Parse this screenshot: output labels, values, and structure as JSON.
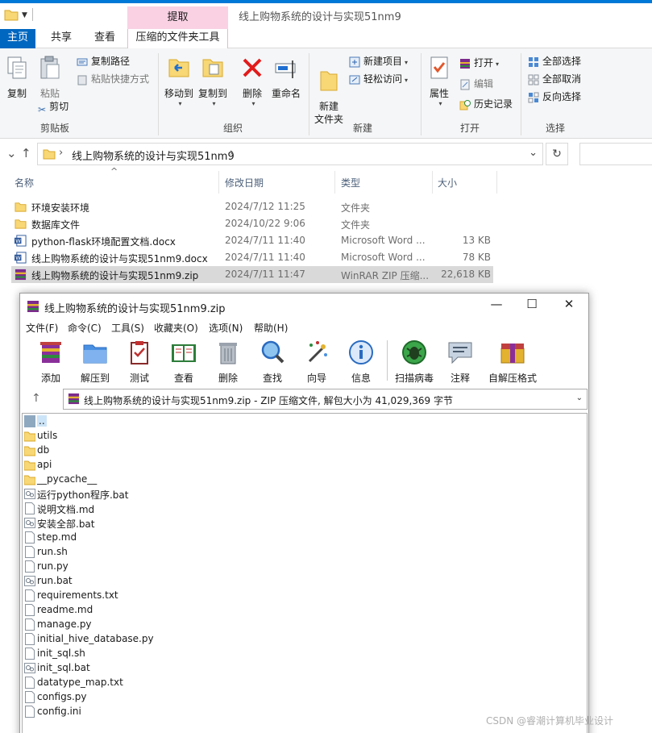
{
  "explorer": {
    "window_title": "线上购物系统的设计与实现51nm9",
    "context_tab_header": "提取",
    "tabs": [
      "主页",
      "共享",
      "查看",
      "压缩的文件夹工具"
    ],
    "ribbon": {
      "clipboard": {
        "group": "剪贴板",
        "copy": "复制",
        "paste": "粘贴",
        "copy_path": "复制路径",
        "paste_shortcut": "粘贴快捷方式",
        "cut": "剪切"
      },
      "organize": {
        "group": "组织",
        "move_to": "移动到",
        "copy_to": "复制到",
        "delete": "删除",
        "rename": "重命名"
      },
      "new": {
        "group": "新建",
        "new_folder": "新建\n文件夹",
        "new_item": "新建项目",
        "easy_access": "轻松访问"
      },
      "open": {
        "group": "打开",
        "properties": "属性",
        "open": "打开",
        "edit": "编辑",
        "history": "历史记录"
      },
      "select": {
        "group": "选择",
        "select_all": "全部选择",
        "select_none": "全部取消",
        "invert": "反向选择"
      }
    },
    "address": {
      "path": "线上购物系统的设计与实现51nm9"
    },
    "columns": {
      "name": "名称",
      "date": "修改日期",
      "type": "类型",
      "size": "大小"
    },
    "files": [
      {
        "name": "环境安装环境",
        "date": "2024/7/12 11:25",
        "type": "文件夹",
        "size": "",
        "icon": "folder-icon"
      },
      {
        "name": "数据库文件",
        "date": "2024/10/22 9:06",
        "type": "文件夹",
        "size": "",
        "icon": "folder-icon"
      },
      {
        "name": "python-flask环境配置文档.docx",
        "date": "2024/7/11 11:40",
        "type": "Microsoft Word ...",
        "size": "13 KB",
        "icon": "word-icon"
      },
      {
        "name": "线上购物系统的设计与实现51nm9.docx",
        "date": "2024/7/11 11:40",
        "type": "Microsoft Word ...",
        "size": "78 KB",
        "icon": "word-icon"
      },
      {
        "name": "线上购物系统的设计与实现51nm9.zip",
        "date": "2024/7/11 11:47",
        "type": "WinRAR ZIP 压缩...",
        "size": "22,618 KB",
        "icon": "winrar-icon"
      }
    ]
  },
  "winrar": {
    "title": "线上购物系统的设计与实现51nm9.zip",
    "menu": [
      "文件(F)",
      "命令(C)",
      "工具(S)",
      "收藏夹(O)",
      "选项(N)",
      "帮助(H)"
    ],
    "toolbar": [
      "添加",
      "解压到",
      "测试",
      "查看",
      "删除",
      "查找",
      "向导",
      "信息",
      "扫描病毒",
      "注释",
      "自解压格式"
    ],
    "path": "线上购物系统的设计与实现51nm9.zip - ZIP 压缩文件, 解包大小为 41,029,369 字节",
    "items": [
      {
        "name": "..",
        "kind": "up"
      },
      {
        "name": "utils",
        "kind": "folder"
      },
      {
        "name": "db",
        "kind": "folder"
      },
      {
        "name": "api",
        "kind": "folder"
      },
      {
        "name": "__pycache__",
        "kind": "folder"
      },
      {
        "name": "运行python程序.bat",
        "kind": "bat"
      },
      {
        "name": "说明文档.md",
        "kind": "file"
      },
      {
        "name": "安装全部.bat",
        "kind": "bat"
      },
      {
        "name": "step.md",
        "kind": "file"
      },
      {
        "name": "run.sh",
        "kind": "file"
      },
      {
        "name": "run.py",
        "kind": "file"
      },
      {
        "name": "run.bat",
        "kind": "bat"
      },
      {
        "name": "requirements.txt",
        "kind": "file"
      },
      {
        "name": "readme.md",
        "kind": "file"
      },
      {
        "name": "manage.py",
        "kind": "file"
      },
      {
        "name": "initial_hive_database.py",
        "kind": "file"
      },
      {
        "name": "init_sql.sh",
        "kind": "file"
      },
      {
        "name": "init_sql.bat",
        "kind": "bat"
      },
      {
        "name": "datatype_map.txt",
        "kind": "file"
      },
      {
        "name": "configs.py",
        "kind": "file"
      },
      {
        "name": "config.ini",
        "kind": "file"
      }
    ]
  },
  "watermark": "CSDN @睿潮计算机毕业设计"
}
